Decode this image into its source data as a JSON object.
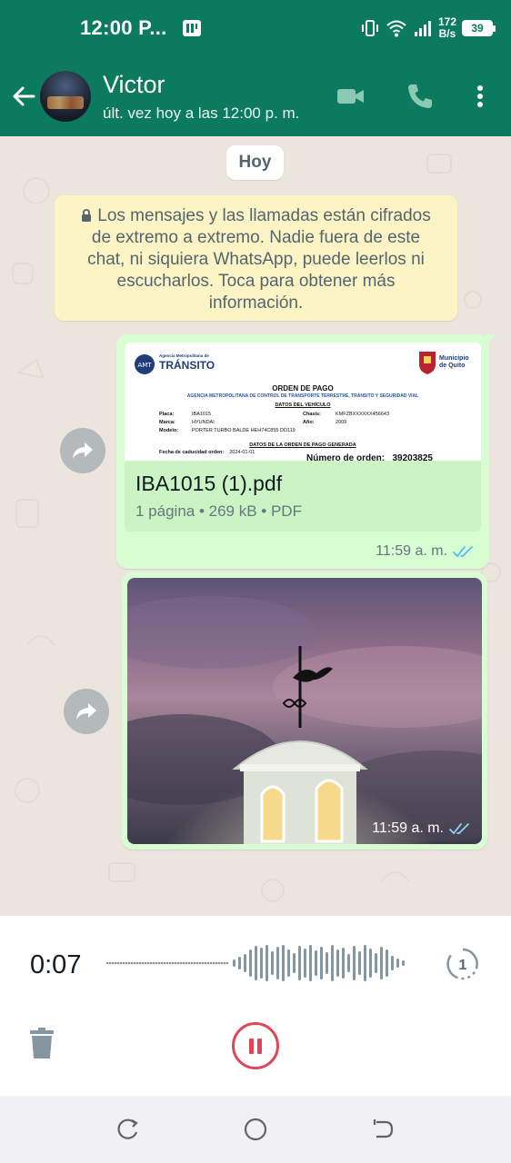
{
  "status_bar": {
    "time": "12:00 P...",
    "net_speed_value": "172",
    "net_speed_unit": "B/s",
    "battery": "39",
    "icons": [
      "app-notification-icon",
      "vibrate-icon",
      "wifi-icon",
      "signal-icon",
      "battery-icon"
    ]
  },
  "header": {
    "contact_name": "Victor",
    "last_seen": "últ. vez hoy a las 12:00 p. m.",
    "icons": [
      "back-arrow-icon",
      "video-call-icon",
      "voice-call-icon",
      "more-vert-icon"
    ],
    "accent_color": "#0b7a5e"
  },
  "chat": {
    "date_chip": "Hoy",
    "encryption_notice": "Los mensajes y las llamadas están cifrados de extremo a extremo. Nadie fuera de este chat, ni siquiera WhatsApp, puede leerlos ni escucharlos. Toca para obtener más información.",
    "messages": [
      {
        "type": "document",
        "file_name": "IBA1015 (1).pdf",
        "meta": "1 página • 269 kB • PDF",
        "time": "11:59 a. m.",
        "status": "read",
        "preview": {
          "agency_small": "Agencia Metropolitana de",
          "agency_big": "TRÁNSITO",
          "municipio": "Municipio de Quito",
          "title": "ORDEN DE PAGO",
          "subtitle": "AGENCIA METROPOLITANA DE CONTROL DE TRANSPORTE TERRESTRE, TRÁNSITO Y SEGURIDAD VIAL",
          "section_vehicle": "DATOS DEL VEHÍCULO",
          "placa_label": "Placa:",
          "placa": "IBA1015",
          "chasis_label": "Chasis:",
          "chasis": "KMFZBXXXXXX456643",
          "marca_label": "Marca:",
          "marca": "HYUNDAI",
          "anio_label": "Año:",
          "anio": "2009",
          "modelo_label": "Modelo:",
          "modelo": "PORTER TURBO BALDE HEH74C855 DD119",
          "section_order": "DATOS DE LA ORDEN DE PAGO GENERADA",
          "caducidad_label": "Fecha de caducidad orden:",
          "caducidad": "2024-01-01",
          "order_label": "Número de orden:",
          "order_number": "39203825"
        }
      },
      {
        "type": "image",
        "description_icon": "photo-weathervane",
        "time": "11:59 a. m.",
        "status": "read"
      }
    ]
  },
  "recorder": {
    "elapsed": "0:07",
    "icons": [
      "playback-speed-icon",
      "trash-icon",
      "pause-icon"
    ],
    "pause_color": "#e04558"
  },
  "navbar": {
    "icons": [
      "recents-icon",
      "home-icon",
      "back-icon"
    ]
  }
}
